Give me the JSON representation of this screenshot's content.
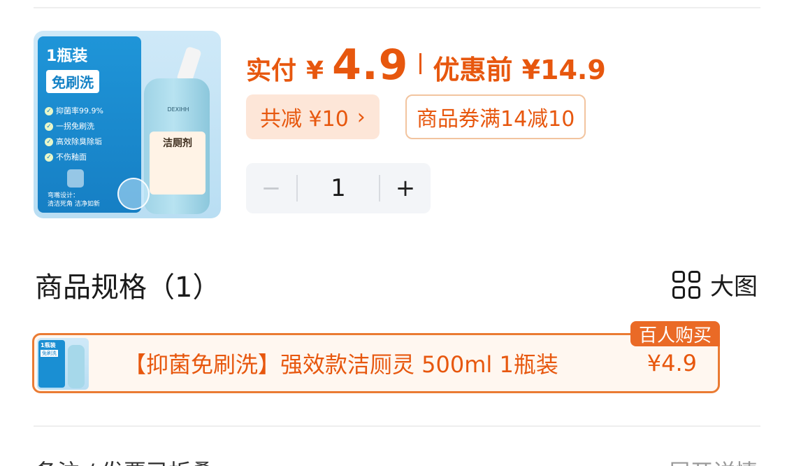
{
  "product": {
    "thumbnail": {
      "badge": "1瓶装",
      "chip": "免刷洗",
      "features": [
        "抑菌率99.9%",
        "一拐免刷洗",
        "高效除臭除垢",
        "不伤釉面"
      ],
      "note_line1": "弯嘴设计：",
      "note_line2": "清洁死角 洁净如新",
      "bottle_brand": "DEXIHH",
      "bottle_label": "洁厕剂"
    },
    "pay_label": "实付",
    "currency": "¥",
    "price": "4.9",
    "original_label": "优惠前 ¥14.9"
  },
  "discount": {
    "total_label": "共减 ¥10",
    "chevron": "›",
    "coupon_label": "商品券满14减10"
  },
  "stepper": {
    "minus": "−",
    "quantity": "1",
    "plus": "+"
  },
  "spec": {
    "title": "商品规格（1）",
    "view_label": "大图",
    "item": {
      "name": "【抑菌免刷洗】强效款洁厕灵 500ml 1瓶装",
      "price": "¥4.9",
      "badge": "百人购买"
    }
  },
  "footer": {
    "left_text": "备注 / 发票已折叠",
    "right_text": "展开详情"
  },
  "colors": {
    "accent": "#e7570e",
    "accent_border": "#ea7b33",
    "chip_bg": "#fde6d8",
    "stepper_bg": "#f3f5f8"
  }
}
